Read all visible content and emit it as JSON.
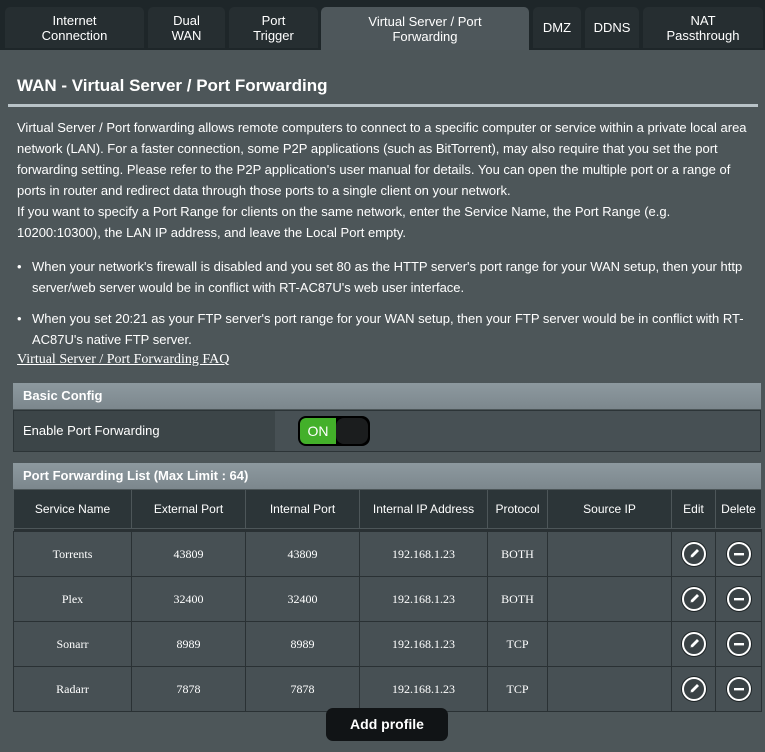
{
  "tabs": [
    {
      "label": "Internet\nConnection",
      "active": false
    },
    {
      "label": "Dual\nWAN",
      "active": false
    },
    {
      "label": "Port\nTrigger",
      "active": false
    },
    {
      "label": "Virtual Server / Port\nForwarding",
      "active": true
    },
    {
      "label": "DMZ",
      "active": false
    },
    {
      "label": "DDNS",
      "active": false
    },
    {
      "label": "NAT\nPassthrough",
      "active": false
    }
  ],
  "page": {
    "title": "WAN - Virtual Server / Port Forwarding",
    "description_1": "Virtual Server / Port forwarding allows remote computers to connect to a specific computer or service within a private local area network (LAN). For a faster connection, some P2P applications (such as BitTorrent), may also require that you set the port forwarding setting. Please refer to the P2P application's user manual for details. You can open the multiple port or a range of ports in router and redirect data through those ports to a single client on your network.",
    "description_2": "If you want to specify a Port Range for clients on the same network, enter the Service Name, the Port Range (e.g. 10200:10300), the LAN IP address, and leave the Local Port empty.",
    "bullet_1": "When your network's firewall is disabled and you set 80 as the HTTP server's port range for your WAN setup, then your http server/web server would be in conflict with RT-AC87U's web user interface.",
    "bullet_2": "When you set 20:21 as your FTP server's port range for your WAN setup, then your FTP server would be in conflict with RT-AC87U's native FTP server.",
    "faq_link": "Virtual Server / Port Forwarding FAQ"
  },
  "basic_config": {
    "header": "Basic Config",
    "enable_label": "Enable Port Forwarding",
    "toggle_state": "ON"
  },
  "port_list": {
    "header": "Port Forwarding List (Max Limit : 64)",
    "columns": [
      "Service Name",
      "External Port",
      "Internal Port",
      "Internal IP Address",
      "Protocol",
      "Source IP",
      "Edit",
      "Delete"
    ],
    "rows": [
      {
        "service": "Torrents",
        "external": "43809",
        "internal": "43809",
        "ip": "192.168.1.23",
        "protocol": "BOTH",
        "source": ""
      },
      {
        "service": "Plex",
        "external": "32400",
        "internal": "32400",
        "ip": "192.168.1.23",
        "protocol": "BOTH",
        "source": ""
      },
      {
        "service": "Sonarr",
        "external": "8989",
        "internal": "8989",
        "ip": "192.168.1.23",
        "protocol": "TCP",
        "source": ""
      },
      {
        "service": "Radarr",
        "external": "7878",
        "internal": "7878",
        "ip": "192.168.1.23",
        "protocol": "TCP",
        "source": ""
      }
    ]
  },
  "add_button": "Add profile",
  "colors": {
    "background": "#4d5659",
    "tab_bar": "#1e2629",
    "section_header": "#8d999f",
    "toggle_on": "#43b02a"
  },
  "icons": {
    "edit": "pencil-icon",
    "delete": "minus-circle-icon"
  }
}
